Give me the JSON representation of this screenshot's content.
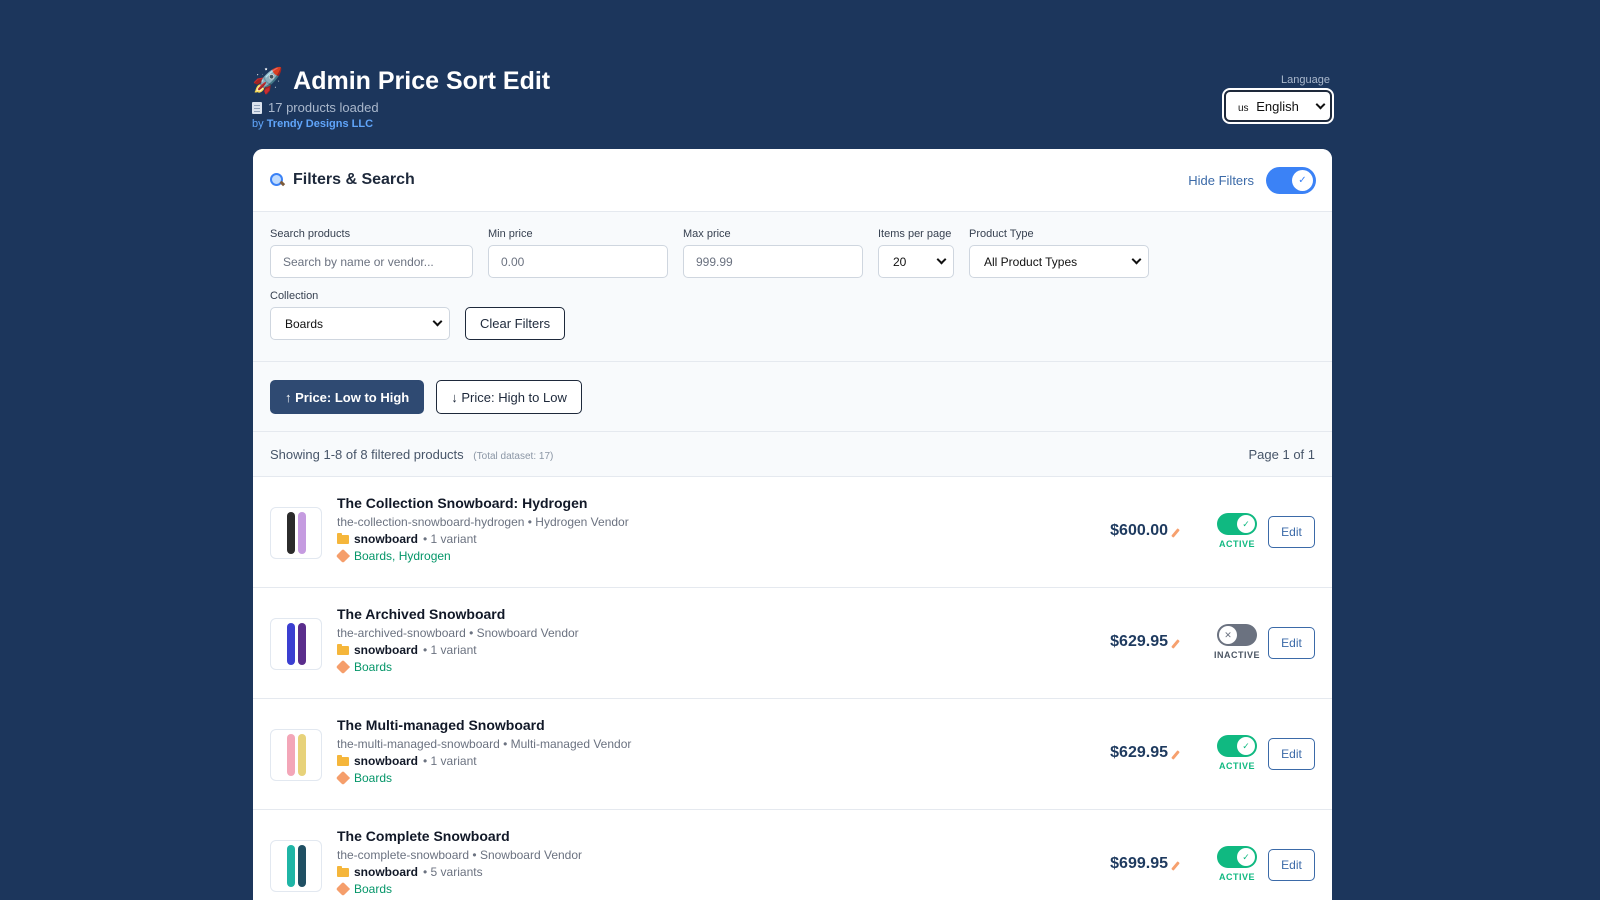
{
  "header": {
    "rocket_glyph": "🚀",
    "title": "Admin Price Sort Edit",
    "products_loaded": "17 products loaded",
    "by_prefix": "by",
    "vendor": "Trendy Designs LLC"
  },
  "language": {
    "label": "Language",
    "flag": "us",
    "selected": "English"
  },
  "filters_card": {
    "title": "Filters & Search",
    "hide_filters_label": "Hide Filters",
    "hide_filters_on": true,
    "search": {
      "label": "Search products",
      "placeholder": "Search by name or vendor..."
    },
    "min_price": {
      "label": "Min price",
      "placeholder": "0.00"
    },
    "max_price": {
      "label": "Max price",
      "placeholder": "999.99"
    },
    "items_per_page": {
      "label": "Items per page",
      "value": "20"
    },
    "product_type": {
      "label": "Product Type",
      "value": "All Product Types"
    },
    "collection": {
      "label": "Collection",
      "value": "Boards"
    },
    "clear_label": "Clear Filters"
  },
  "sort": {
    "low_to_high": "↑ Price: Low to High",
    "high_to_low": "↓ Price: High to Low",
    "active": "low_to_high"
  },
  "summary": {
    "showing": "Showing 1-8 of 8 filtered products",
    "total": "(Total dataset: 17)",
    "page": "Page 1 of 1"
  },
  "products": [
    {
      "name": "The Collection Snowboard: Hydrogen",
      "handle_vendor": "the-collection-snowboard-hydrogen • Hydrogen Vendor",
      "type": "snowboard",
      "variants": "• 1 variant",
      "collections": "Boards, Hydrogen",
      "price": "$600.00",
      "status": "ACTIVE",
      "active": true,
      "edit_label": "Edit",
      "board_colors": [
        "#2b2b2b",
        "#c59be0"
      ]
    },
    {
      "name": "The Archived Snowboard",
      "handle_vendor": "the-archived-snowboard • Snowboard Vendor",
      "type": "snowboard",
      "variants": "• 1 variant",
      "collections": "Boards",
      "price": "$629.95",
      "status": "INACTIVE",
      "active": false,
      "edit_label": "Edit",
      "board_colors": [
        "#3b3fd1",
        "#5a2d8c"
      ]
    },
    {
      "name": "The Multi-managed Snowboard",
      "handle_vendor": "the-multi-managed-snowboard • Multi-managed Vendor",
      "type": "snowboard",
      "variants": "• 1 variant",
      "collections": "Boards",
      "price": "$629.95",
      "status": "ACTIVE",
      "active": true,
      "edit_label": "Edit",
      "board_colors": [
        "#f3a6b8",
        "#e7d27a"
      ]
    },
    {
      "name": "The Complete Snowboard",
      "handle_vendor": "the-complete-snowboard • Snowboard Vendor",
      "type": "snowboard",
      "variants": "• 5 variants",
      "collections": "Boards",
      "price": "$699.95",
      "status": "ACTIVE",
      "active": true,
      "edit_label": "Edit",
      "board_colors": [
        "#1fb5a6",
        "#1f4f63"
      ]
    }
  ]
}
